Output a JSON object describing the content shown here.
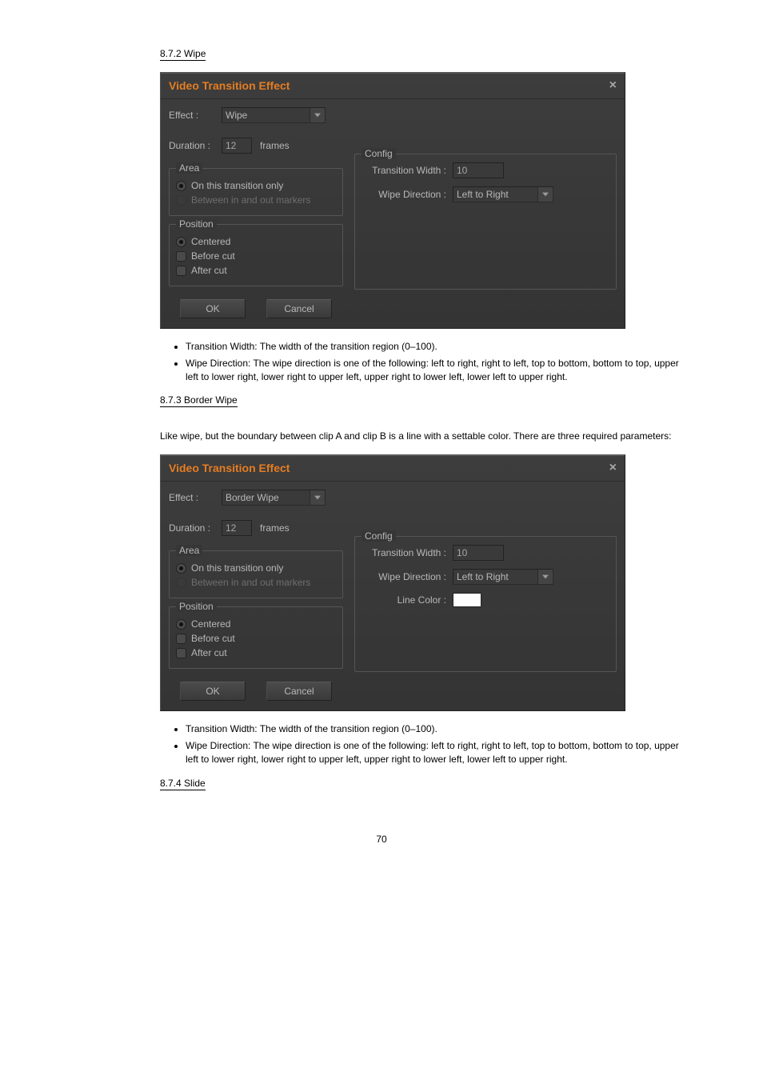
{
  "page_number": "70",
  "heading_wipe": "8.7.2 Wipe",
  "heading_border_wipe": "8.7.3 Border Wipe",
  "heading_slide": "8.7.4 Slide",
  "wipe_bullets": [
    "Transition Width: The width of the transition region (0–100).",
    "Wipe Direction: The wipe direction is one of the following: left to right, right to left, top to bottom, bottom to top, upper left to lower right, lower right to upper left, upper right to lower left, lower left to upper right."
  ],
  "border_wipe_intro": "Like wipe, but the boundary between clip A and clip B is a line with a settable color. There are three required parameters:",
  "border_wipe_bullets": [
    "Transition Width: The width of the transition region (0–100).",
    "Wipe Direction: The wipe direction is one of the following: left to right, right to left, top to bottom, bottom to top, upper left to lower right, lower right to upper left, upper right to lower left, lower left to upper right."
  ],
  "dialog1": {
    "title": "Video Transition Effect",
    "effect_label": "Effect :",
    "effect_value": "Wipe",
    "duration_label": "Duration :",
    "duration_value": "12",
    "duration_unit": "frames",
    "area_legend": "Area",
    "area_opt1": "On this transition only",
    "area_opt2": "Between in and out markers",
    "position_legend": "Position",
    "pos_opt1": "Centered",
    "pos_opt2": "Before cut",
    "pos_opt3": "After cut",
    "config_legend": "Config",
    "tw_label": "Transition Width :",
    "tw_value": "10",
    "wd_label": "Wipe Direction :",
    "wd_value": "Left to Right",
    "ok": "OK",
    "cancel": "Cancel"
  },
  "dialog2": {
    "title": "Video Transition Effect",
    "effect_label": "Effect :",
    "effect_value": "Border Wipe",
    "duration_label": "Duration :",
    "duration_value": "12",
    "duration_unit": "frames",
    "area_legend": "Area",
    "area_opt1": "On this transition only",
    "area_opt2": "Between in and out markers",
    "position_legend": "Position",
    "pos_opt1": "Centered",
    "pos_opt2": "Before cut",
    "pos_opt3": "After cut",
    "config_legend": "Config",
    "tw_label": "Transition Width :",
    "tw_value": "10",
    "wd_label": "Wipe Direction :",
    "wd_value": "Left to Right",
    "lc_label": "Line Color :",
    "ok": "OK",
    "cancel": "Cancel"
  }
}
